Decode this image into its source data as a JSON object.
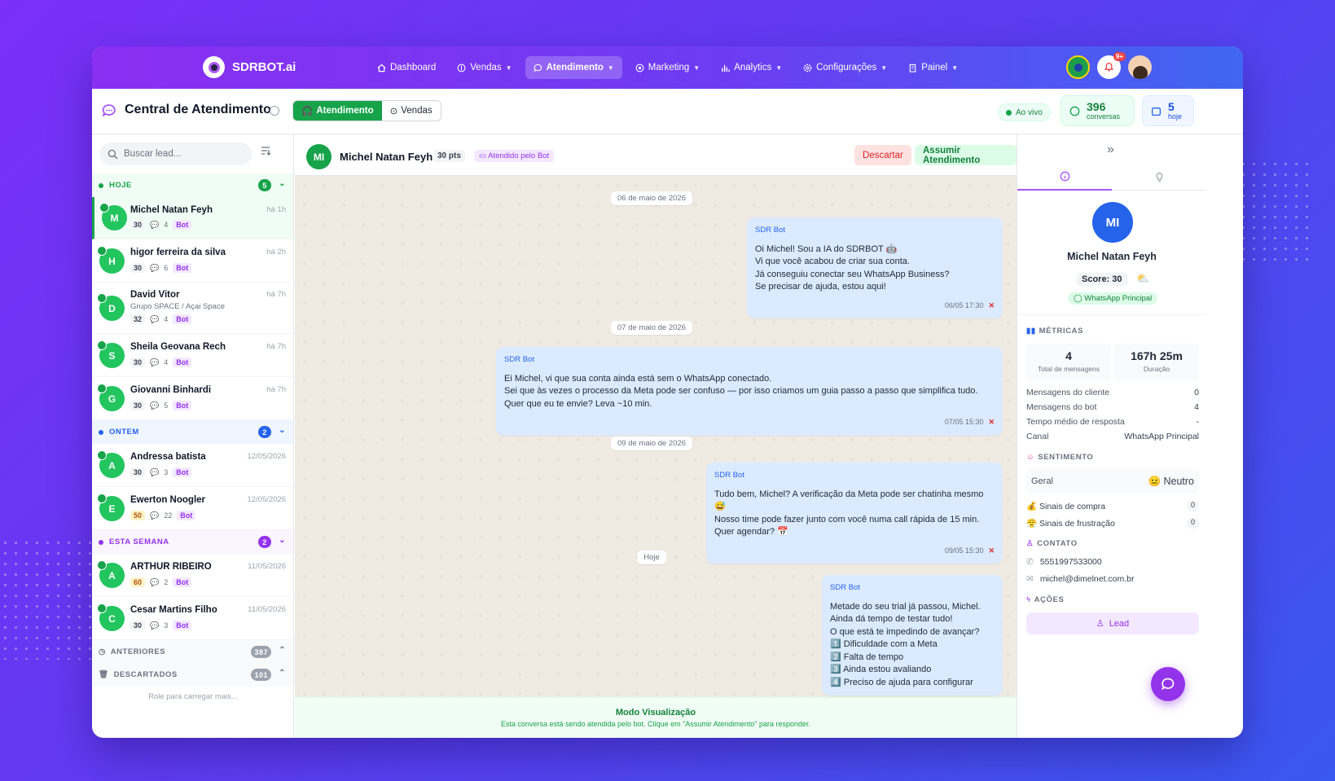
{
  "nav": {
    "brand": "SDRBOT.ai",
    "menu": [
      "Dashboard",
      "Vendas",
      "Atendimento",
      "Marketing",
      "Analytics",
      "Configurações",
      "Painel"
    ],
    "notif_badge": "9+"
  },
  "header": {
    "title": "Central de Atendimento",
    "seg_atendimento": "Atendimento",
    "seg_vendas": "Vendas",
    "live": "Ao vivo",
    "conv_count": "396",
    "conv_label": "conversas",
    "today_count": "5",
    "today_label": "hoje"
  },
  "leads": {
    "search_placeholder": "Buscar lead...",
    "groups": {
      "hoje": {
        "label": "HOJE",
        "count": "5",
        "color": "#16a34a"
      },
      "ontem": {
        "label": "ONTEM",
        "count": "2",
        "color": "#2563eb"
      },
      "semana": {
        "label": "ESTA SEMANA",
        "count": "2",
        "color": "#9333ea"
      },
      "anteriores": {
        "label": "ANTERIORES",
        "count": "387"
      },
      "descartados": {
        "label": "DESCARTADOS",
        "count": "101"
      }
    },
    "items": [
      {
        "initial": "M",
        "name": "Michel Natan Feyh",
        "time": "há 1h",
        "score": "30",
        "msgs": "4",
        "tag": "Bot",
        "sub": ""
      },
      {
        "initial": "H",
        "name": "higor ferreira da silva",
        "time": "há 2h",
        "score": "30",
        "msgs": "6",
        "tag": "Bot",
        "sub": ""
      },
      {
        "initial": "D",
        "name": "David Vitor",
        "time": "há 7h",
        "score": "32",
        "msgs": "4",
        "tag": "Bot",
        "sub": "Grupo SPACE / Açai Space"
      },
      {
        "initial": "S",
        "name": "Sheila Geovana Rech",
        "time": "há 7h",
        "score": "30",
        "msgs": "4",
        "tag": "Bot",
        "sub": ""
      },
      {
        "initial": "G",
        "name": "Giovanni Binhardi",
        "time": "há 7h",
        "score": "30",
        "msgs": "5",
        "tag": "Bot",
        "sub": ""
      },
      {
        "initial": "A",
        "name": "Andressa batista",
        "time": "12/05/2026",
        "score": "30",
        "msgs": "3",
        "tag": "Bot",
        "sub": ""
      },
      {
        "initial": "E",
        "name": "Ewerton Noogler",
        "time": "12/05/2026",
        "score": "50",
        "msgs": "22",
        "tag": "Bot",
        "sub": ""
      },
      {
        "initial": "A",
        "name": "ARTHUR RIBEIRO",
        "time": "11/05/2026",
        "score": "60",
        "msgs": "2",
        "tag": "Bot",
        "sub": ""
      },
      {
        "initial": "C",
        "name": "Cesar Martins Filho",
        "time": "11/05/2026",
        "score": "30",
        "msgs": "3",
        "tag": "Bot",
        "sub": ""
      }
    ],
    "load_more": "Role para carregar mais..."
  },
  "chat": {
    "initials": "MI",
    "name": "Michel Natan Feyh",
    "points": "30 pts",
    "bot_badge": "Atendido pelo Bot",
    "discard": "Descartar",
    "assume": "Assumir Atendimento",
    "dates": [
      "06 de maio de 2026",
      "07 de maio de 2026",
      "09 de maio de 2026",
      "Hoje"
    ],
    "messages": [
      {
        "sender": "SDR Bot",
        "text": "Oi Michel! Sou a IA do SDRBOT 🤖\nVi que você acabou de criar sua conta.\nJá conseguiu conectar seu WhatsApp Business?\nSe precisar de ajuda, estou aqui!",
        "time": "06/05 17:30"
      },
      {
        "sender": "SDR Bot",
        "text": "Ei Michel, vi que sua conta ainda está sem o WhatsApp conectado.\nSei que às vezes o processo da Meta pode ser confuso — por isso criamos um guia passo a passo que simplifica tudo.\nQuer que eu te envie? Leva ~10 min.",
        "time": "07/05 15:30"
      },
      {
        "sender": "SDR Bot",
        "text": "Tudo bem, Michel? A verificação da Meta pode ser chatinha mesmo 😅\nNosso time pode fazer junto com você numa call rápida de 15 min.\nQuer agendar? 📅",
        "time": "09/05 15:30"
      },
      {
        "sender": "SDR Bot",
        "text": "Metade do seu trial já passou, Michel.\nAinda dá tempo de testar tudo!\nO que está te impedindo de avançar?\n1️⃣ Dificuldade com a Meta\n2️⃣ Falta de tempo\n3️⃣ Ainda estou avaliando\n4️⃣ Preciso de ajuda para configurar",
        "time": ""
      }
    ],
    "view_title": "Modo Visualização",
    "view_sub": "Esta conversa está sendo atendida pelo bot. Clique em \"Assumir Atendimento\" para responder."
  },
  "profile": {
    "initials": "MI",
    "name": "Michel Natan Feyh",
    "score": "Score: 30",
    "channel_badge": "WhatsApp Principal",
    "metrics_title": "MÉTRICAS",
    "total_msgs": "4",
    "total_msgs_label": "Total de mensagens",
    "duration": "167h 25m",
    "duration_label": "Duração",
    "kv": [
      {
        "k": "Mensagens do cliente",
        "v": "0"
      },
      {
        "k": "Mensagens do bot",
        "v": "4"
      },
      {
        "k": "Tempo médio de resposta",
        "v": "-"
      },
      {
        "k": "Canal",
        "v": "WhatsApp Principal"
      }
    ],
    "sentiment_title": "SENTIMENTO",
    "geral": "Geral",
    "neutral": "😐 Neutro",
    "buy_signals": "💰 Sinais de compra",
    "buy_count": "0",
    "frust_signals": "😤 Sinais de frustração",
    "frust_count": "0",
    "contact_title": "CONTATO",
    "phone": "5551997533000",
    "email": "michel@dimelnet.com.br",
    "actions_title": "AÇÕES",
    "lead_button": "Lead"
  }
}
